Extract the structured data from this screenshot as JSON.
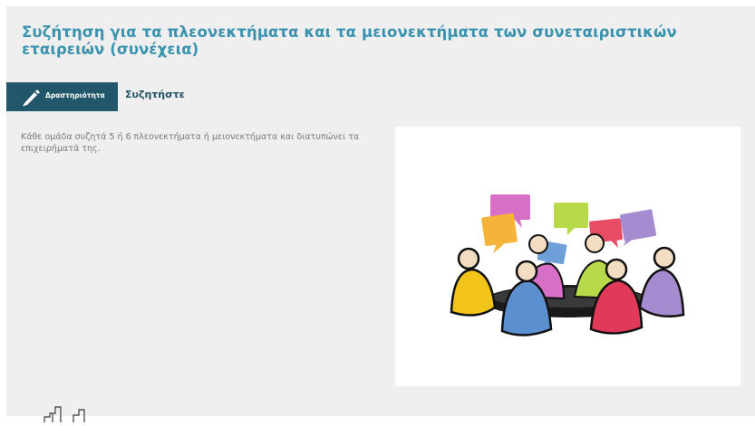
{
  "page": {
    "title": "Συζήτηση για τα πλεονεκτήματα και τα μειονεκτήματα των συνεταιριστικών εταιρειών (συνέχεια)"
  },
  "activity": {
    "badge_label": "Δραστηριότητα",
    "badge_icon": "pencil-icon",
    "type_label": "Συζητήστε"
  },
  "content": {
    "description": "Κάθε ομάδα συζητά 5 ή 6 πλεονεκτήματα ή μειονεκτήματα και διατυπώνει τα επιχειρήματά της."
  },
  "illustration": {
    "icon": "group-discussion-illustration"
  },
  "footer": {
    "icon": "bar-chart-icon"
  },
  "colors": {
    "title": "#3a93ae",
    "badge_bg": "#22566a",
    "type_label": "#1f4f63",
    "body_text": "#7a7a7a",
    "page_bg": "#efefef"
  }
}
